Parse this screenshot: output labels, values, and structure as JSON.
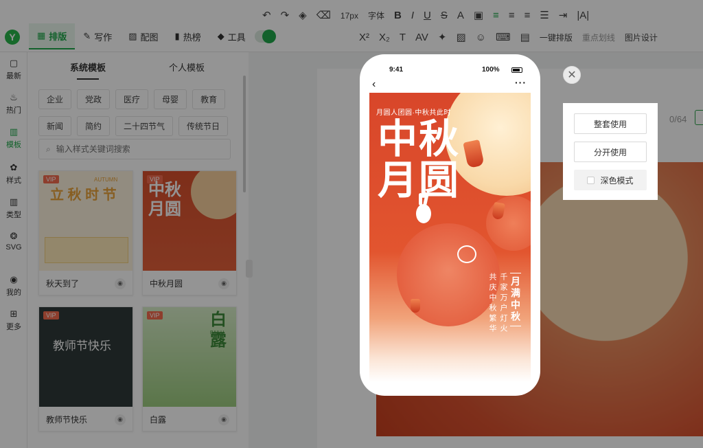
{
  "toolbar": {
    "font_size": "17px",
    "font_label": "字体",
    "row2": [
      "一键排版",
      "重点划线",
      "图片设计"
    ]
  },
  "topnav": {
    "logo": "Y",
    "items": [
      {
        "label": "排版",
        "icon": "layout-icon"
      },
      {
        "label": "写作",
        "icon": "pen-icon"
      },
      {
        "label": "配图",
        "icon": "image-icon"
      },
      {
        "label": "热榜",
        "icon": "bookmark-icon"
      },
      {
        "label": "工具",
        "icon": "cube-icon"
      }
    ]
  },
  "rail": {
    "items": [
      {
        "label": "最新",
        "icon": "chat-icon"
      },
      {
        "label": "热门",
        "icon": "flame-icon"
      },
      {
        "label": "模板",
        "icon": "template-icon"
      },
      {
        "label": "样式",
        "icon": "style-icon"
      },
      {
        "label": "类型",
        "icon": "grid-icon"
      },
      {
        "label": "SVG",
        "icon": "svg-icon"
      },
      {
        "label": "我的",
        "icon": "user-icon"
      },
      {
        "label": "更多",
        "icon": "more-icon"
      }
    ]
  },
  "panel": {
    "tabs": [
      "系统模板",
      "个人模板"
    ],
    "tags": [
      "企业",
      "党政",
      "医疗",
      "母婴",
      "教育",
      "新闻",
      "简约",
      "二十四节气",
      "传统节日"
    ],
    "search_placeholder": "输入样式关键词搜索",
    "cards": [
      {
        "name": "秋天到了",
        "thumb_title": "立 秋 时 节",
        "thumb_sub": "AUTUMN",
        "badge": "VIP"
      },
      {
        "name": "中秋月圆",
        "thumb_title": "中秋\n月圆",
        "badge": "VIP"
      },
      {
        "name": "教师节快乐",
        "thumb_title": "教师节快乐",
        "badge": "VIP"
      },
      {
        "name": "白露",
        "thumb_title": "白\n露",
        "thumb_sub": "BAILU",
        "badge": "VIP"
      }
    ]
  },
  "editor": {
    "counter": "0/64"
  },
  "preview": {
    "status_time": "9:41",
    "status_battery": "100%",
    "poster": {
      "subtitle": "月圆人团圆·中秋共此时",
      "title": "中秋\n月圆",
      "vertical_1": "共庆中秋繁华",
      "vertical_2": "千家万户灯火",
      "vertical_3": "月满中秋"
    }
  },
  "actions": {
    "use_all": "整套使用",
    "use_split": "分开使用",
    "dark_mode": "深色模式"
  },
  "colors": {
    "brand": "#1fa84a",
    "poster_red": "#d8462a"
  }
}
